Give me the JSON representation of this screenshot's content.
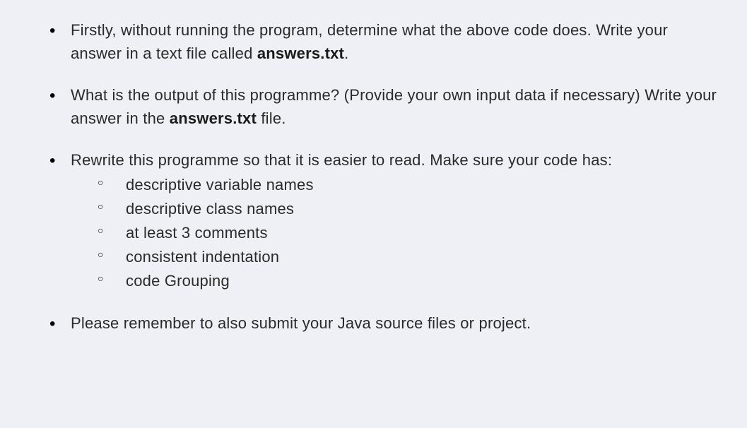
{
  "bullets": [
    {
      "parts": [
        {
          "text": "Firstly, without running the program, determine what the above code does. Write your answer in a text file called ",
          "bold": false
        },
        {
          "text": "answers.txt",
          "bold": true
        },
        {
          "text": ".",
          "bold": false
        }
      ]
    },
    {
      "parts": [
        {
          "text": "What is the output of this programme? (Provide your own input data if necessary)  Write your answer in the ",
          "bold": false
        },
        {
          "text": "answers.txt",
          "bold": true
        },
        {
          "text": " file.",
          "bold": false
        }
      ]
    },
    {
      "parts": [
        {
          "text": "Rewrite this programme so that it is easier to read. Make sure your code has:",
          "bold": false
        }
      ],
      "sub": [
        "descriptive variable names",
        "descriptive class names",
        "at least 3 comments",
        "consistent indentation",
        "code Grouping"
      ]
    },
    {
      "parts": [
        {
          "text": "Please remember to also submit your Java source files or project.",
          "bold": false
        }
      ]
    }
  ]
}
